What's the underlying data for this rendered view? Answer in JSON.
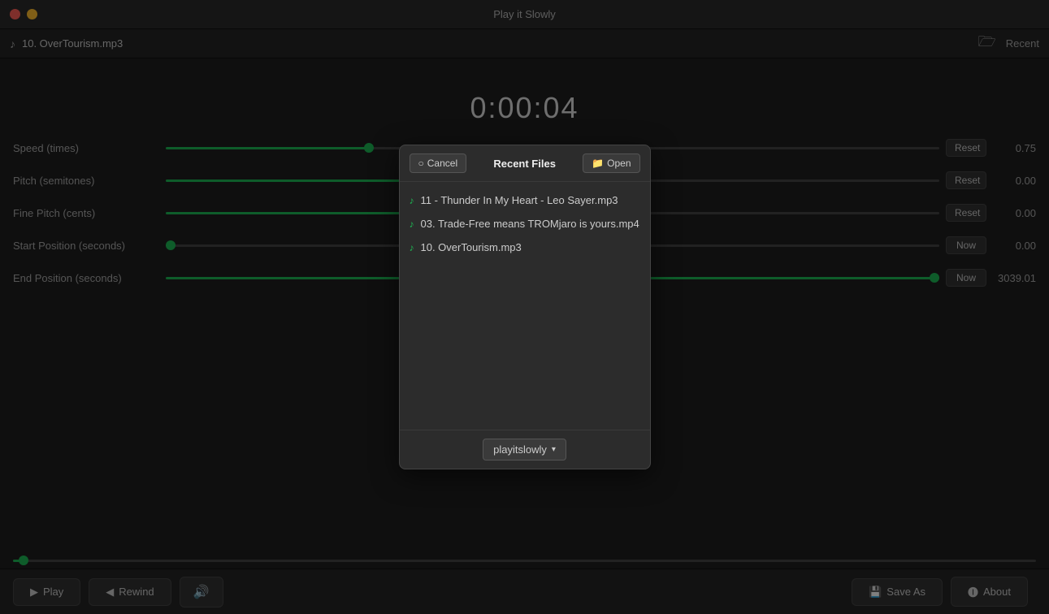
{
  "app": {
    "title": "Play it Slowly",
    "current_file": "10. OverTourism.mp3"
  },
  "titlebar": {
    "close_label": "",
    "minimize_label": ""
  },
  "filebar": {
    "file_icon": "♪",
    "file_name": "10. OverTourism.mp3",
    "folder_icon": "🗁",
    "recent_label": "Recent"
  },
  "timer": {
    "display": "0:00:04",
    "sub": "..."
  },
  "controls": {
    "speed": {
      "label": "Speed (times)",
      "value": "0.75",
      "reset_label": "Reset",
      "pct": 26
    },
    "pitch": {
      "label": "Pitch (semitones)",
      "value": "0.00",
      "reset_label": "Reset",
      "pct": 50
    },
    "fine_pitch": {
      "label": "Fine Pitch (cents)",
      "value": "0.00",
      "reset_label": "Reset",
      "pct": 50
    },
    "start_pos": {
      "label": "Start Position (seconds)",
      "value": "0.00",
      "reset_label": "Now",
      "pct": 0
    },
    "end_pos": {
      "label": "End Position (seconds)",
      "value": "3039.01",
      "reset_label": "Now",
      "pct": 100
    }
  },
  "bottom_bar": {
    "play_label": "Play",
    "play_icon": "▶",
    "rewind_label": "Rewind",
    "rewind_icon": "◀",
    "volume_icon": "🔊",
    "save_as_label": "Save As",
    "save_as_icon": "💾",
    "about_label": "About",
    "about_icon": "🅘"
  },
  "modal": {
    "title": "Recent Files",
    "cancel_label": "Cancel",
    "cancel_icon": "○",
    "open_label": "Open",
    "open_icon": "📁",
    "files": [
      {
        "name": "11 - Thunder In My Heart - Leo Sayer.mp3",
        "icon": "♪"
      },
      {
        "name": "03. Trade-Free means TROMjaro is yours.mp4",
        "icon": "♪"
      },
      {
        "name": "10. OverTourism.mp3",
        "icon": "♪"
      }
    ],
    "profile_label": "playitslowly",
    "profile_arrow": "▾"
  }
}
